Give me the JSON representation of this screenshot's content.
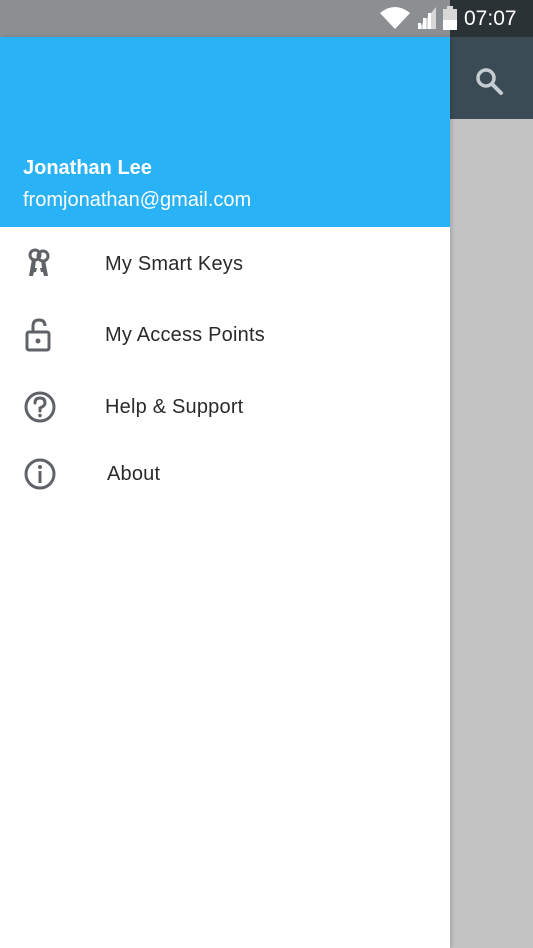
{
  "status_bar": {
    "time": "07:07",
    "icons": [
      "wifi-icon",
      "signal-icon",
      "battery-icon"
    ]
  },
  "app": {
    "toolbar_icon": "search-icon"
  },
  "drawer": {
    "header_color": "#29b2f5",
    "user_name": "Jonathan Lee",
    "user_email": "fromjonathan@gmail.com",
    "items": [
      {
        "label": "My Smart Keys",
        "icon": "keys-icon"
      },
      {
        "label": "My Access Points",
        "icon": "lock-icon"
      },
      {
        "label": "Help & Support",
        "icon": "help-icon"
      },
      {
        "label": "About",
        "icon": "info-icon"
      }
    ]
  },
  "colors": {
    "accent": "#29b2f5",
    "toolbar": "#3a4b56",
    "scrim": "#c4c4c4"
  }
}
